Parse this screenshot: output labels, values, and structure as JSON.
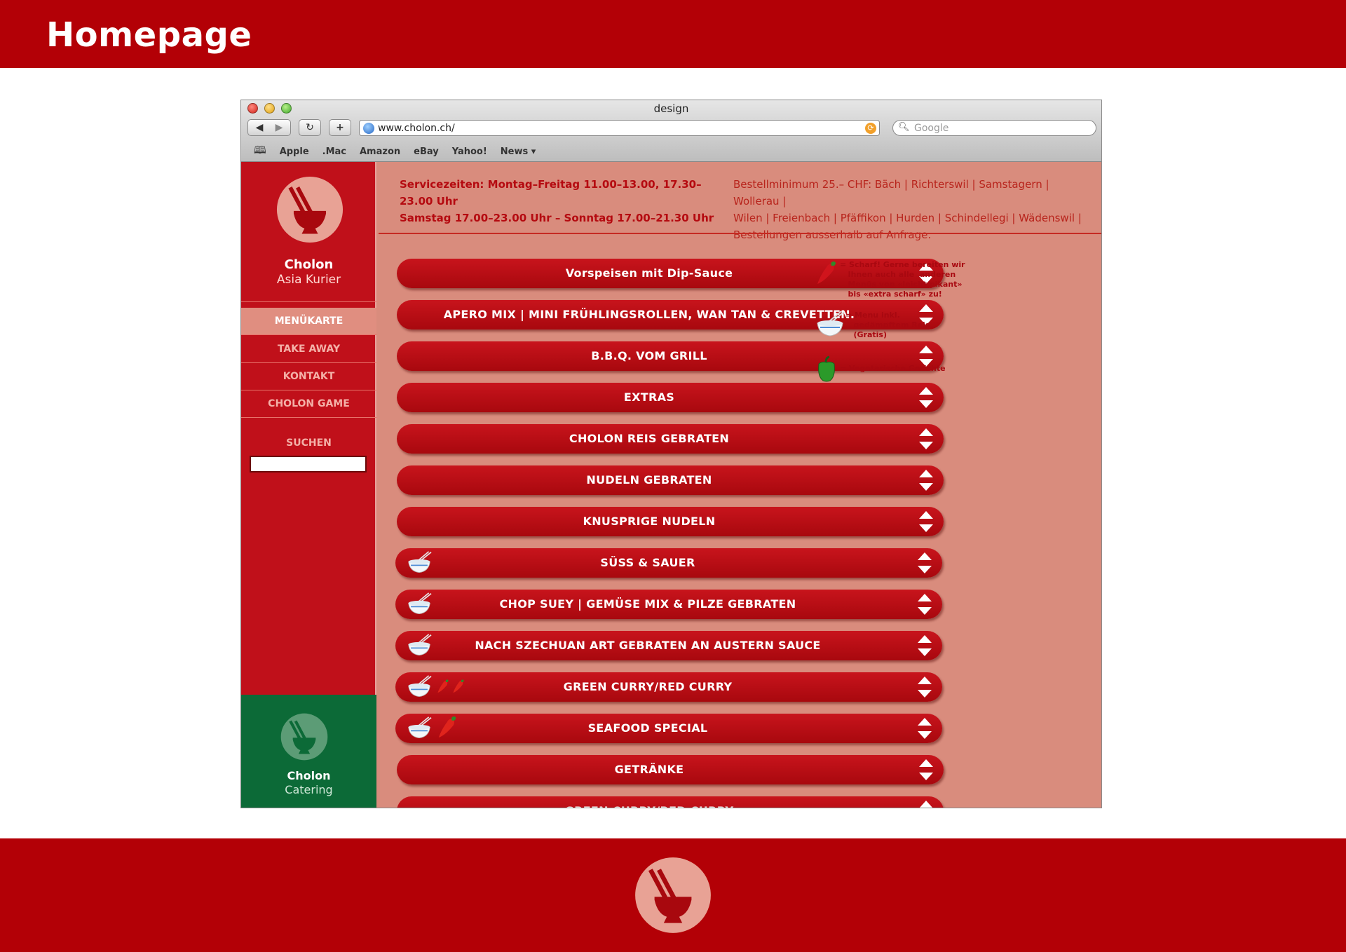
{
  "slide": {
    "title": "Homepage"
  },
  "browser": {
    "window_title": "design",
    "url": "www.cholon.ch/",
    "search_placeholder": "Google",
    "bookmarks": [
      "Apple",
      ".Mac",
      "Amazon",
      "eBay",
      "Yahoo!",
      "News ▾"
    ]
  },
  "sidebar": {
    "brand_name": "Cholon",
    "brand_sub": "Asia Kurier",
    "nav": [
      "MENÜKARTE",
      "TAKE AWAY",
      "KONTAKT",
      "CHOLON GAME"
    ],
    "active_index": 0,
    "search_label": "SUCHEN",
    "catering_name": "Cholon",
    "catering_sub": "Catering"
  },
  "info": {
    "service_line1": "Servicezeiten: Montag–Freitag 11.00–13.00, 17.30–23.00 Uhr",
    "service_line2": "Samstag  17.00–23.00 Uhr – Sonntag  17.00–21.30 Uhr",
    "delivery_line1": "Bestellminimum 25.– CHF:  Bäch | Richterswil | Samstagern | Wollerau |",
    "delivery_line2": "Wilen | Freienbach | Pfäffikon | Hurden | Schindellegi | Wädenswil |",
    "delivery_line3": "Bestellungen ausserhalb auf Anfrage."
  },
  "menu": [
    {
      "label": "Vorspeisen mit Dip-Sauce",
      "bowl": false,
      "chili": 0
    },
    {
      "label": "APERO MIX | MINI FRÜHLINGSROLLEN, WAN TAN & CREVETTEN.",
      "bowl": false,
      "chili": 0
    },
    {
      "label": "B.B.Q. VOM GRILL",
      "bowl": false,
      "chili": 0
    },
    {
      "label": "EXTRAS",
      "bowl": false,
      "chili": 0
    },
    {
      "label": "CHOLON REIS GEBRATEN",
      "bowl": false,
      "chili": 0
    },
    {
      "label": "NUDELN GEBRATEN",
      "bowl": false,
      "chili": 0
    },
    {
      "label": "KNUSPRIGE NUDELN",
      "bowl": false,
      "chili": 0
    },
    {
      "label": "SÜSS & SAUER",
      "bowl": true,
      "chili": 0
    },
    {
      "label": "CHOP SUEY | GEMÜSE MIX & PILZE GEBRATEN",
      "bowl": true,
      "chili": 0
    },
    {
      "label": "NACH SZECHUAN ART GEBRATEN AN AUSTERN SAUCE",
      "bowl": true,
      "chili": 0
    },
    {
      "label": "GREEN CURRY/RED CURRY",
      "bowl": true,
      "chili": 2
    },
    {
      "label": "SEAFOOD SPECIAL",
      "bowl": true,
      "chili": 1
    },
    {
      "label": "GETRÄNKE",
      "bowl": false,
      "chili": 0
    },
    {
      "label": "GREEN CURRY/RED CURRY",
      "bowl": false,
      "chili": 0
    }
  ],
  "legend": {
    "spicy": "= Scharf! Gerne bereiten wir\n   Ihnen auch alle  anderen\n   Menüs von «leicht pikant»\n   bis «extra scharf» zu!",
    "rice": "= Menu inkl.\n   gedämpftem Reis\n   (Gratis)",
    "veg": "= Vegetarische Gerichte"
  },
  "colors": {
    "brand_red": "#b30006",
    "page_bg": "#d98c7d",
    "catering_green": "#0c6a37"
  }
}
